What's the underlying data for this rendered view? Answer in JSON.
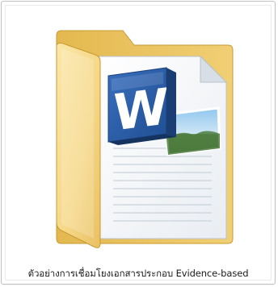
{
  "item": {
    "label": "ตัวอย่างการเชื่อมโยงเอกสารประกอบ Evidence-based",
    "icon": "folder-with-word-document-icon",
    "selected": true
  },
  "colors": {
    "tile_border": "#c2c2c2",
    "folder_back": "#e8c15c",
    "folder_front": "#f6d98a",
    "word_blue": "#2b5797",
    "label_text": "#1a1a1a"
  }
}
